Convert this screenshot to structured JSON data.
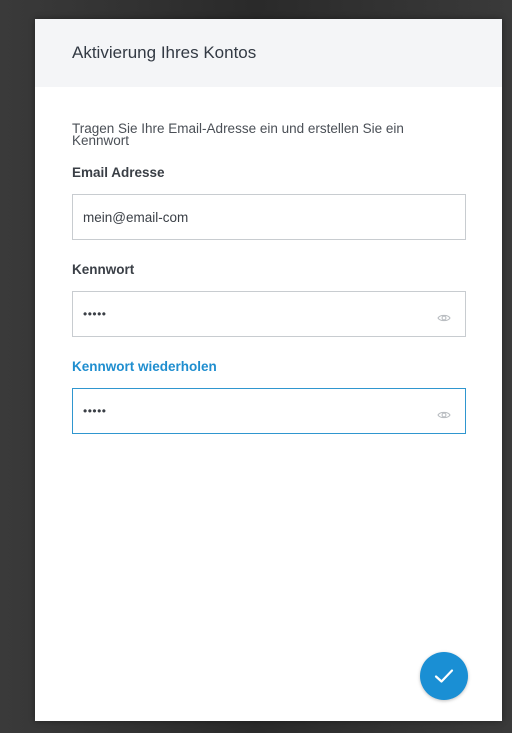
{
  "dialog": {
    "title": "Aktivierung Ihres Kontos",
    "intro": "Tragen Sie Ihre Email-Adresse ein und erstellen Sie ein Kennwort"
  },
  "fields": {
    "email": {
      "label": "Email Adresse",
      "value": "mein@email-com"
    },
    "password": {
      "label": "Kennwort",
      "value": "•••••",
      "icon": "eye-icon"
    },
    "password_repeat": {
      "label": "Kennwort wiederholen",
      "value": "•••••",
      "icon": "eye-icon",
      "focused": true
    }
  },
  "actions": {
    "confirm_icon": "checkmark-icon"
  },
  "colors": {
    "accent": "#1a8fd4",
    "header_bg": "#f4f5f7",
    "backdrop": "#2f2f2f"
  }
}
